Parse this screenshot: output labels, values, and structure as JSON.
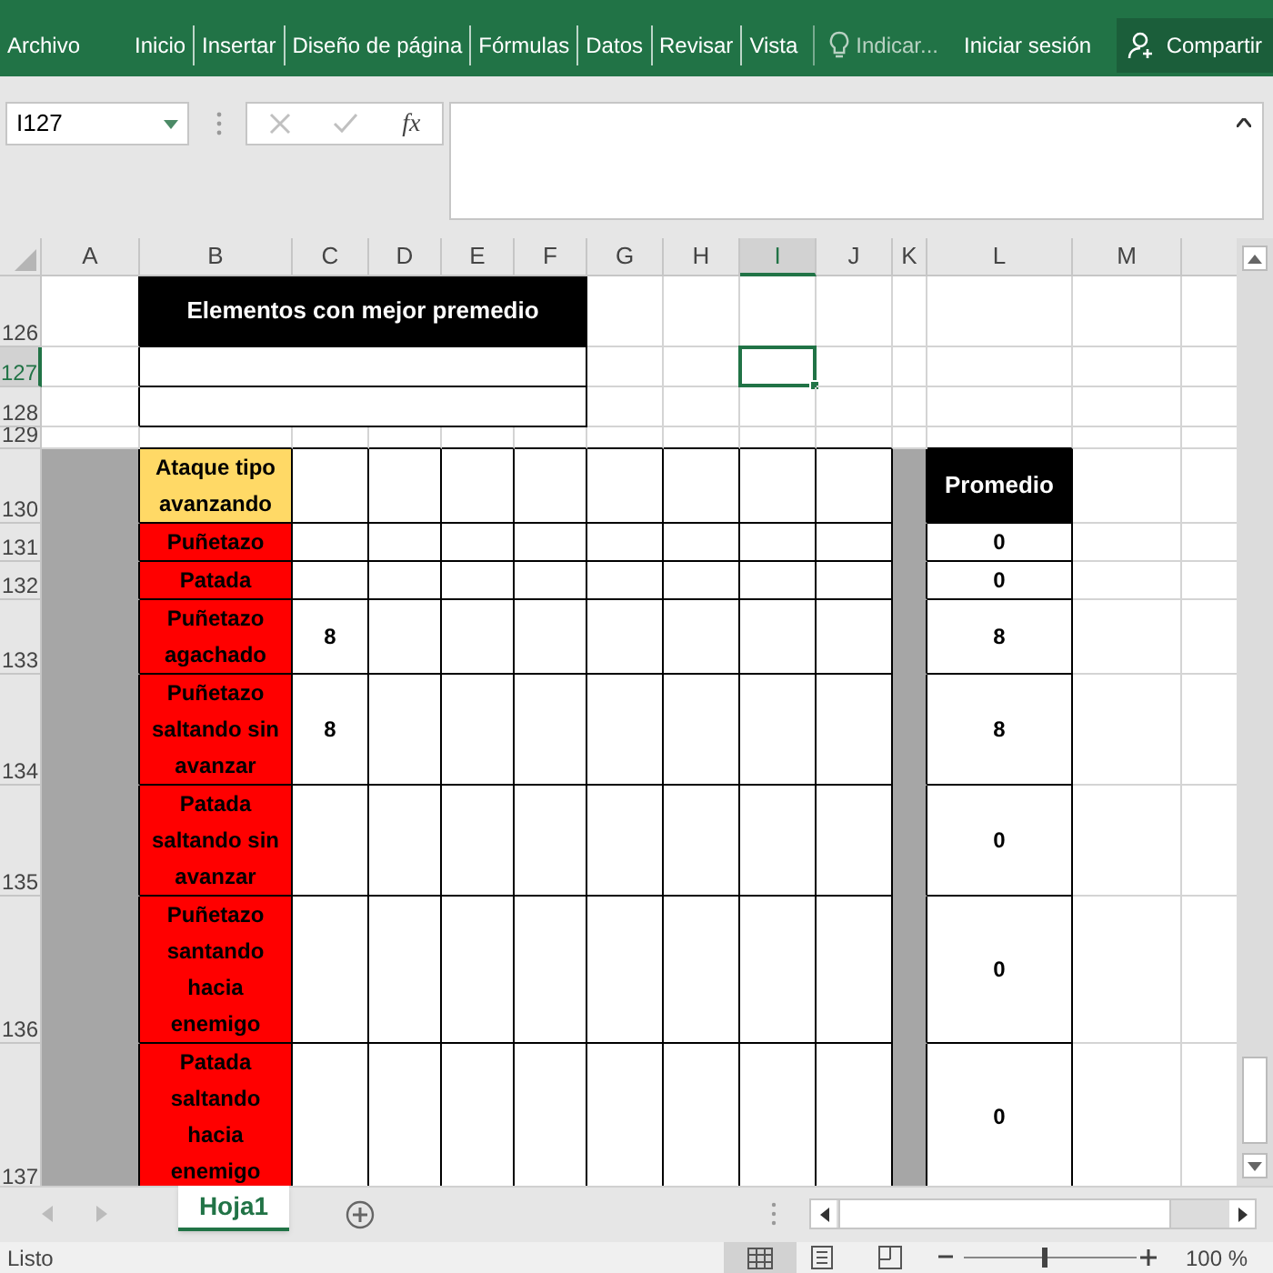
{
  "ribbon": {
    "tabs": [
      "Archivo",
      "Inicio",
      "Insertar",
      "Diseño de página",
      "Fórmulas",
      "Datos",
      "Revisar",
      "Vista"
    ],
    "tell_me": "Indicar...",
    "sign_in": "Iniciar sesión",
    "share": "Compartir"
  },
  "formula_bar": {
    "name_box": "I127",
    "function_label": "fx"
  },
  "sheet": {
    "columns": [
      {
        "name": "A",
        "selected": false
      },
      {
        "name": "B",
        "selected": false
      },
      {
        "name": "C",
        "selected": false
      },
      {
        "name": "D",
        "selected": false
      },
      {
        "name": "E",
        "selected": false
      },
      {
        "name": "F",
        "selected": false
      },
      {
        "name": "G",
        "selected": false
      },
      {
        "name": "H",
        "selected": false
      },
      {
        "name": "I",
        "selected": true
      },
      {
        "name": "J",
        "selected": false
      },
      {
        "name": "K",
        "selected": false
      },
      {
        "name": "L",
        "selected": false
      },
      {
        "name": "M",
        "selected": false
      }
    ],
    "rows": [
      {
        "number": "126",
        "selected": false,
        "kind": "title",
        "text": "Elementos con mejor premedio"
      },
      {
        "number": "127",
        "selected": true,
        "kind": "box"
      },
      {
        "number": "128",
        "selected": false,
        "kind": "box"
      },
      {
        "number": "129",
        "selected": false,
        "kind": "spacer"
      },
      {
        "number": "130",
        "selected": false,
        "kind": "header",
        "label": "Ataque tipo avanzando",
        "average": "Promedio"
      },
      {
        "number": "131",
        "selected": false,
        "kind": "data",
        "label": "Puñetazo",
        "average": "0"
      },
      {
        "number": "132",
        "selected": false,
        "kind": "data",
        "label": "Patada",
        "average": "0"
      },
      {
        "number": "133",
        "selected": false,
        "kind": "data",
        "label": "Puñetazo agachado",
        "col_c": "8",
        "average": "8"
      },
      {
        "number": "134",
        "selected": false,
        "kind": "data",
        "label": "Puñetazo saltando sin avanzar",
        "col_c": "8",
        "average": "8"
      },
      {
        "number": "135",
        "selected": false,
        "kind": "data",
        "label": "Patada saltando sin avanzar",
        "average": "0"
      },
      {
        "number": "136",
        "selected": false,
        "kind": "data",
        "label": "Puñetazo santando hacia enemigo",
        "average": "0"
      },
      {
        "number": "137",
        "selected": false,
        "kind": "data",
        "label": "Patada saltando hacia enemigo",
        "average": "0"
      }
    ]
  },
  "sheet_tabs": [
    {
      "label": "Hoja1",
      "selected": true
    }
  ],
  "status_bar": {
    "status": "Listo",
    "zoom": "100 %",
    "zoom_slider": {
      "level": 0.47
    }
  }
}
